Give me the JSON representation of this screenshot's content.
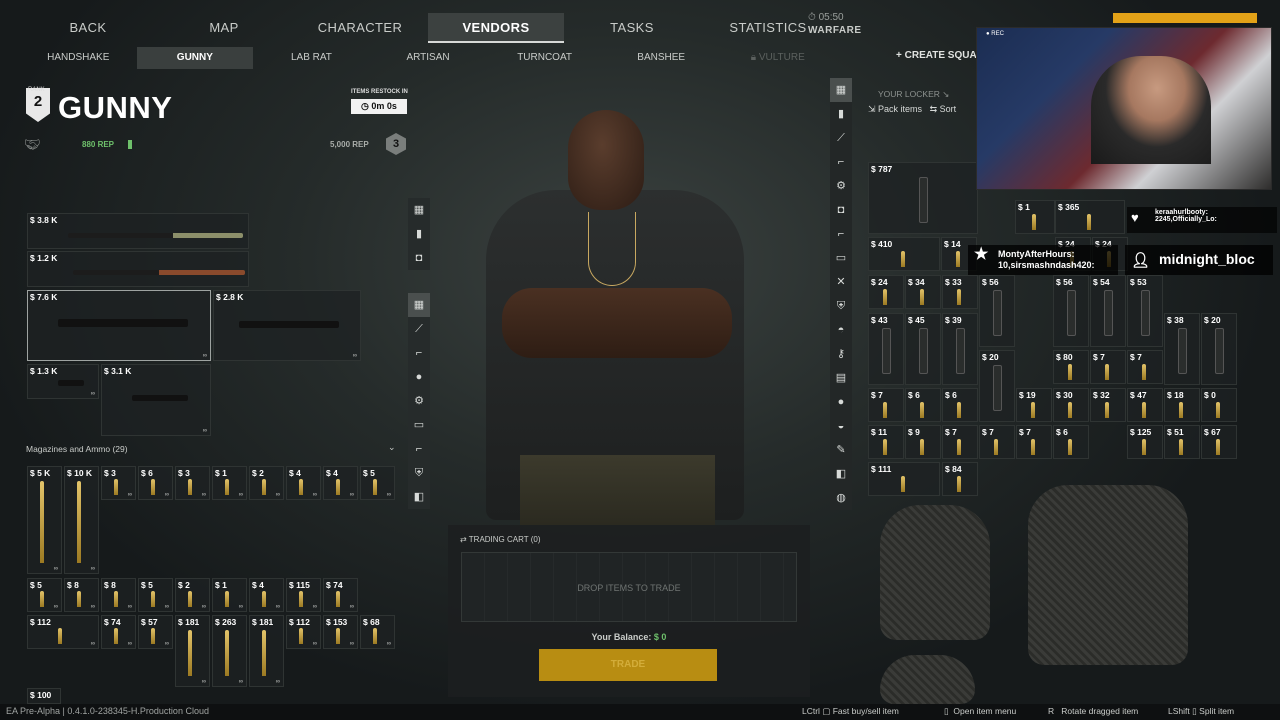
{
  "nav": {
    "tabs": [
      {
        "label": "BACK"
      },
      {
        "label": "MAP"
      },
      {
        "label": "CHARACTER"
      },
      {
        "label": "VENDORS"
      },
      {
        "label": "TASKS"
      },
      {
        "label": "STATISTICS"
      }
    ],
    "active_tab": "VENDORS",
    "clock": "05:50",
    "mode": "WARFARE"
  },
  "vendors": {
    "items": [
      {
        "label": "HANDSHAKE"
      },
      {
        "label": "GUNNY"
      },
      {
        "label": "LAB RAT"
      },
      {
        "label": "ARTISAN"
      },
      {
        "label": "TURNCOAT"
      },
      {
        "label": "BANSHEE"
      },
      {
        "label": "VULTURE"
      }
    ],
    "active": "GUNNY",
    "locked": "VULTURE"
  },
  "vendor": {
    "rank_label": "RANK",
    "rank": "2",
    "name": "GUNNY",
    "restock_label": "ITEMS RESTOCK IN",
    "restock_time": "0m 0s",
    "current_rep": "880 REP",
    "required_rep": "5,000 REP",
    "next_rank": "3"
  },
  "weapons": [
    {
      "price": "$ 3.8 K"
    },
    {
      "price": "$ 1.2 K"
    },
    {
      "price": "$ 7.6 K"
    },
    {
      "price": "$ 2.8 K"
    },
    {
      "price": "$ 1.3 K"
    },
    {
      "price": "$ 3.1 K"
    }
  ],
  "ammo_section": {
    "title": "Magazines and Ammo (29)"
  },
  "ammo_row1": [
    "$ 5 K",
    "$ 10 K",
    "$ 3",
    "$ 6",
    "$ 3",
    "$ 1",
    "$ 2",
    "$ 4",
    "$ 4",
    "$ 5"
  ],
  "ammo_row2": [
    "$ 5",
    "$ 8",
    "$ 8",
    "$ 5",
    "$ 2",
    "$ 1",
    "$ 4",
    "$ 115",
    "$ 74"
  ],
  "ammo_row3": [
    "$ 112",
    "$ 74",
    "$ 57",
    "$ 181",
    "$ 263",
    "$ 181",
    "$ 112",
    "$ 153",
    "$ 68"
  ],
  "ammo_row4": [
    "$ 100"
  ],
  "cart": {
    "title": "TRADING CART (0)",
    "drop_text": "DROP ITEMS TO TRADE",
    "balance_label": "Your Balance:",
    "balance_value": "$ 0",
    "trade_label": "TRADE"
  },
  "locker": {
    "create_squad": "CREATE SQUA",
    "title": "YOUR LOCKER",
    "pack_items": "Pack items",
    "sort": "Sort",
    "rows": [
      [
        "$ 787",
        "$ 1",
        "$ 365"
      ],
      [
        "$ 410",
        "$ 14",
        "$ 24",
        "$ 24"
      ],
      [
        "$ 24",
        "$ 34",
        "$ 33",
        "$ 56",
        "$ 56",
        "$ 54",
        "$ 53"
      ],
      [
        "$ 43",
        "$ 45",
        "$ 39",
        "$ 38",
        "$ 20"
      ],
      [
        "$ 20",
        "$ 80",
        "$ 7",
        "$ 7"
      ],
      [
        "$ 7",
        "$ 6",
        "$ 6",
        "$ 19",
        "$ 30",
        "$ 32",
        "$ 47",
        "$ 18",
        "$ 0"
      ],
      [
        "$ 11",
        "$ 9",
        "$ 7",
        "$ 7",
        "$ 7",
        "$ 6",
        "$ 125",
        "$ 51",
        "$ 67"
      ],
      [
        "$ 111",
        "$ 84"
      ]
    ]
  },
  "stream": {
    "rec": "REC",
    "chat1_user": "keraahurlbooty:",
    "chat1_text": "2245,Officially_Lo:",
    "chat2_user": "MontyAfterHours:",
    "chat2_text": "10,sirsmashndash420:",
    "chat3_text": "midnight_bloc"
  },
  "footer": {
    "version": "EA Pre-Alpha | 0.4.1.0-238345-H.Production Cloud",
    "hints": [
      {
        "key": "LCtrl",
        "label": "Fast buy/sell item"
      },
      {
        "key": "",
        "label": "Open item menu"
      },
      {
        "key": "R",
        "label": "Rotate dragged item"
      },
      {
        "key": "LShift",
        "label": "Split item"
      }
    ]
  },
  "colors": {
    "accent_green": "#6ec06b",
    "trade_gold": "#b88d12",
    "stream_yellow": "#e3a218"
  }
}
